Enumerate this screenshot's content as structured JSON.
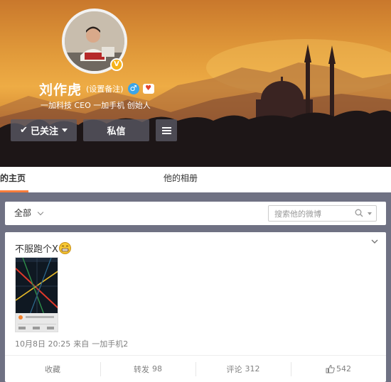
{
  "profile": {
    "name": "刘作虎",
    "remark_link": "(设置备注)",
    "gender_icon": "male-icon",
    "level_icon": "heart-badge-icon",
    "verified_icon": "verified-v-icon",
    "bio": "一加科技 CEO 一加手机 创始人",
    "follow_button": "已关注",
    "message_button": "私信",
    "more_icon": "menu-icon"
  },
  "tabs": [
    {
      "label": "的主页",
      "active": true
    },
    {
      "label": "他的相册",
      "active": false
    }
  ],
  "filter": {
    "all_label": "全部",
    "search_placeholder": "搜索他的微博"
  },
  "post": {
    "text": "不服跑个X",
    "emoji": "grin-emoji-icon",
    "date": "10月8日 20:25",
    "source_prefix": "来自",
    "source": "一加手机2",
    "actions": {
      "favorite": "收藏",
      "repost_label": "转发",
      "repost_count": "98",
      "comment_label": "评论",
      "comment_count": "312",
      "like_count": "542"
    }
  },
  "colors": {
    "accent_tab": "#fa7d3c",
    "page_bg": "#6f7183",
    "verified": "#f6b21a",
    "gender": "#3ca5e8"
  }
}
